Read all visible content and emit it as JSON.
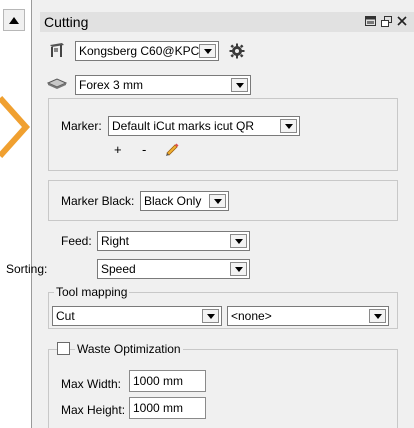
{
  "panel": {
    "title": "Cutting",
    "header_icons": [
      "restore-window-icon",
      "float-window-icon",
      "close-icon"
    ]
  },
  "device": {
    "icon": "cutter-icon",
    "value": "Kongsberg C60@KPCS",
    "settings_icon": "gear-icon"
  },
  "material": {
    "icon": "material-sheet-icon",
    "value": "Forex 3 mm"
  },
  "marker": {
    "label": "Marker:",
    "value": "Default iCut marks icut QR",
    "add_label": "+",
    "remove_label": "-",
    "edit_icon": "pencil-icon"
  },
  "marker_black": {
    "label": "Marker Black:",
    "value": "Black Only"
  },
  "feed": {
    "label": "Feed:",
    "value": "Right"
  },
  "sorting": {
    "label": "Sorting:",
    "value": "Speed"
  },
  "tool_mapping": {
    "legend": "Tool mapping",
    "left_value": "Cut",
    "right_value": "<none>"
  },
  "waste": {
    "legend": "Waste Optimization",
    "checked": false,
    "max_width_label": "Max Width:",
    "max_width_value": "1000 mm",
    "max_height_label": "Max Height:",
    "max_height_value": "1000 mm"
  },
  "colors": {
    "accent_orange": "#f0a030",
    "panel_bg": "#f0f0f0",
    "header_bg": "#e1e1e1"
  }
}
